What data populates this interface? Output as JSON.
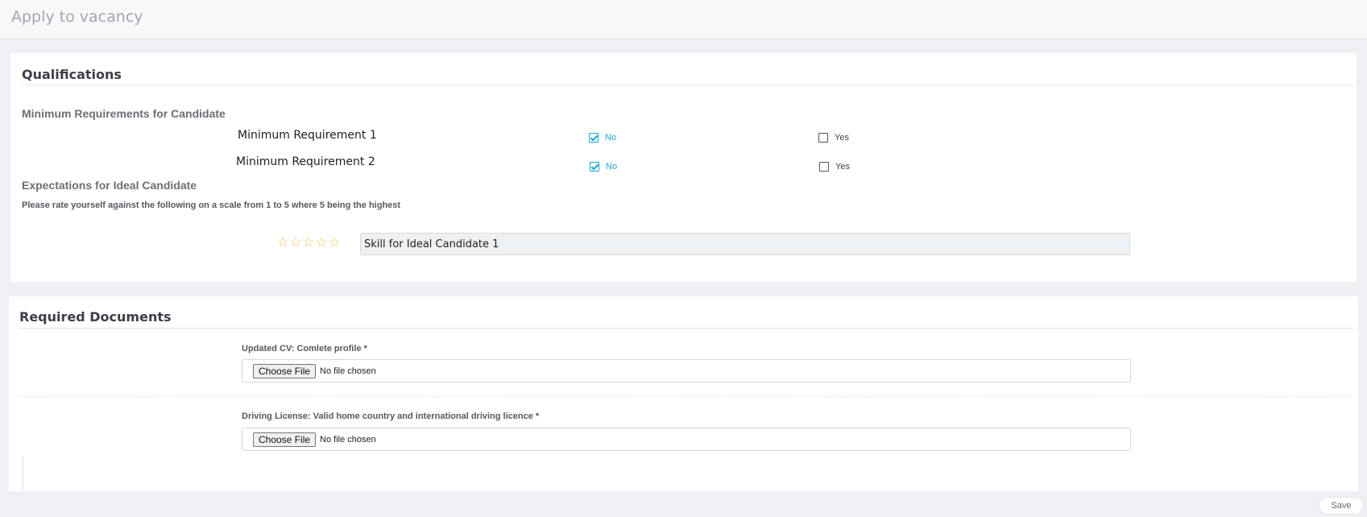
{
  "header": {
    "title": "Apply to vacancy"
  },
  "qualifications": {
    "title": "Qualifications",
    "minimum_heading": "Minimum Requirements for Candidate",
    "requirements": [
      {
        "label": "Minimum Requirement 1",
        "no_label": "No",
        "yes_label": "Yes",
        "selected": "No"
      },
      {
        "label": "Minimum Requirement 2",
        "no_label": "No",
        "yes_label": "Yes",
        "selected": "No"
      }
    ],
    "expectations_heading": "Expectations for Ideal Candidate",
    "instructions": "Please rate yourself against the following on a scale from 1 to 5 where 5 being the highest",
    "skills": [
      {
        "label": "Skill for Ideal Candidate 1",
        "rating": 0,
        "max_rating": 5,
        "star_icon": "star-outline-icon"
      }
    ]
  },
  "documents": {
    "title": "Required Documents",
    "items": [
      {
        "label": "Updated CV: Comlete profile *",
        "button": "Choose File",
        "status": "No file chosen"
      },
      {
        "label": "Driving License: Valid home country and international driving licence *",
        "button": "Choose File",
        "status": "No file chosen"
      }
    ]
  },
  "actions": {
    "save_label": "Save"
  },
  "colors": {
    "accent": "#1aa6d6",
    "star": "#f2c14e",
    "background": "#eef0f4"
  }
}
